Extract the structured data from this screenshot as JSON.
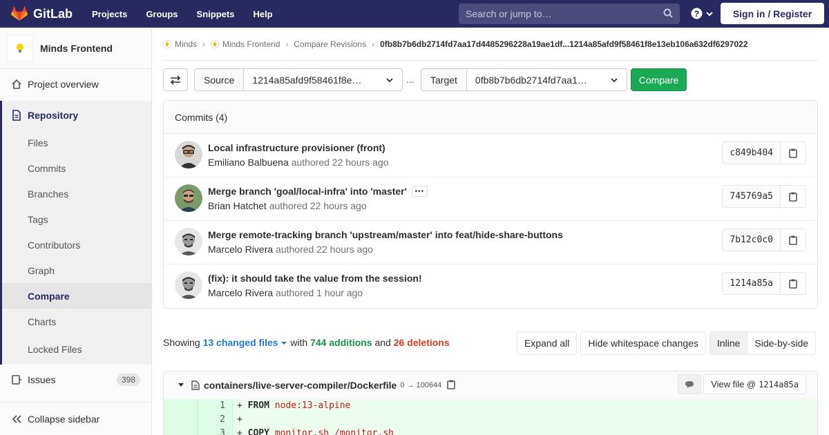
{
  "topnav": {
    "brand": "GitLab",
    "links": [
      "Projects",
      "Groups",
      "Snippets",
      "Help"
    ],
    "search_placeholder": "Search or jump to…",
    "signin": "Sign in / Register"
  },
  "sidebar": {
    "project_name": "Minds Frontend",
    "overview": "Project overview",
    "repository": "Repository",
    "repo_items": [
      "Files",
      "Commits",
      "Branches",
      "Tags",
      "Contributors",
      "Graph",
      "Compare",
      "Charts",
      "Locked Files"
    ],
    "active_item": "Compare",
    "issues": "Issues",
    "issues_count": "398",
    "collapse": "Collapse sidebar"
  },
  "breadcrumb": {
    "items": [
      "Minds",
      "Minds Frontend",
      "Compare Revisions"
    ],
    "current": "0fb8b7b6db2714fd7aa17d4485296228a19ae1df...1214a85afd9f58461f8e13eb106a632df6297022"
  },
  "compare": {
    "source_label": "Source",
    "source_value": "1214a85afd9f58461f8e…",
    "ellipsis": "...",
    "target_label": "Target",
    "target_value": "0fb8b7b6db2714fd7aa1…",
    "compare_button": "Compare"
  },
  "commits": {
    "header": "Commits (4)",
    "items": [
      {
        "title": "Local infrastructure provisioner (front)",
        "author": "Emiliano Balbuena",
        "meta": "authored 22 hours ago",
        "sha": "c849b404"
      },
      {
        "title": "Merge branch 'goal/local-infra' into 'master'",
        "author": "Brian Hatchet",
        "meta": "authored 22 hours ago",
        "sha": "745769a5",
        "ellipsis": "•••"
      },
      {
        "title": "Merge remote-tracking branch 'upstream/master' into feat/hide-share-buttons",
        "author": "Marcelo Rivera",
        "meta": "authored 22 hours ago",
        "sha": "7b12c0c0"
      },
      {
        "title": "(fix): it should take the value from the session!",
        "author": "Marcelo Rivera",
        "meta": "authored 1 hour ago",
        "sha": "1214a85a"
      }
    ]
  },
  "summary": {
    "showing": "Showing",
    "changed_files": "13 changed files",
    "with": "with",
    "additions": "744 additions",
    "and": "and",
    "deletions": "26 deletions"
  },
  "buttons": {
    "expand_all": "Expand all",
    "hide_whitespace": "Hide whitespace changes",
    "inline": "Inline",
    "side_by_side": "Side-by-side"
  },
  "file": {
    "path": "containers/live-server-compiler/Dockerfile",
    "mode": "0 → 100644",
    "view_file": "View file @",
    "view_sha": "1214a85a"
  },
  "diff_lines": [
    {
      "num": "1",
      "sign": "+",
      "kw": "FROM",
      "rest": "node:13-alpine"
    },
    {
      "num": "2",
      "sign": "+",
      "kw": "",
      "rest": ""
    },
    {
      "num": "3",
      "sign": "+",
      "kw": "COPY",
      "rest": "monitor.sh /monitor.sh"
    }
  ]
}
